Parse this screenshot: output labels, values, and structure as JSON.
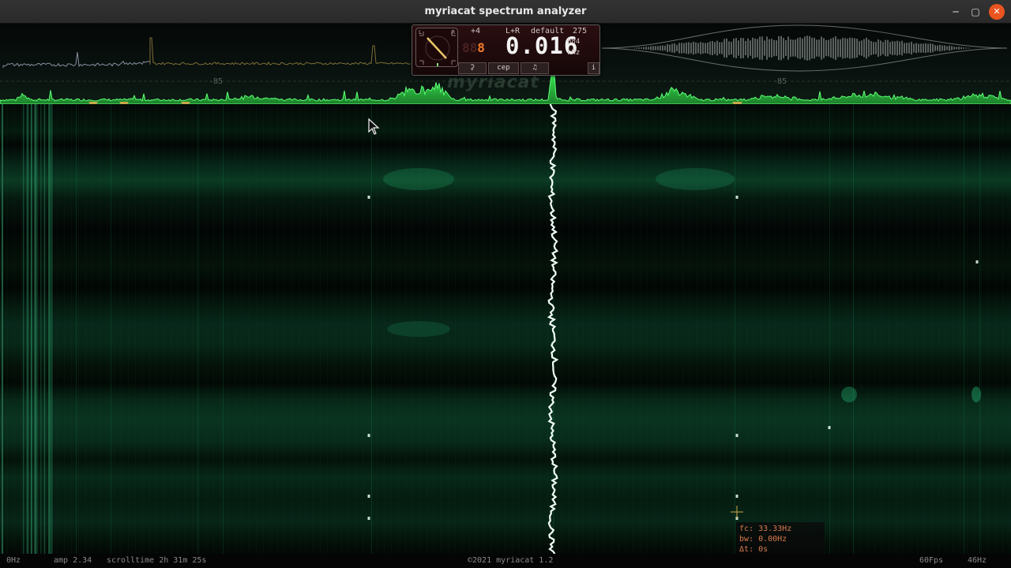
{
  "window": {
    "title": "myriacat spectrum analyzer",
    "minimize_glyph": "─",
    "maximize_glyph": "▢",
    "close_glyph": "✕"
  },
  "spectrum": {
    "db_label_left": "-85",
    "db_label_right": "-85",
    "watermark": "myriacat"
  },
  "panel": {
    "channel_offset": "+4",
    "channel_mode": "L+R",
    "preset": "default",
    "preset_value": "275",
    "digits_small_dim": "88",
    "digits_small_lit": "8",
    "big_frequency": "0.016",
    "frequency_sub_value": "684",
    "frequency_unit": "kHz",
    "dial_labels": {
      "left": "L",
      "right": "R"
    },
    "buttons": {
      "tuning_fork": "⚳",
      "cep": "cep",
      "note": "♫",
      "info": "i"
    }
  },
  "readout": {
    "fc": "fc: 33.33Hz",
    "bw": "bw: 0.00Hz",
    "dt": "Δt: 0s"
  },
  "status": {
    "zero": "0Hz",
    "amp": "amp 2.34",
    "scrolltime": "scrolltime 2h 31m 25s",
    "copyright": "©2021 myriacat 1.2",
    "fps": "60Fps",
    "max_freq": "46Hz"
  },
  "colors": {
    "spectrum_green": "#3dff5a",
    "waterfall_green": "#2ad68c",
    "marker_yellow": "#c9a94a",
    "readout_orange": "#d77a4d",
    "close_button": "#e9541f"
  }
}
